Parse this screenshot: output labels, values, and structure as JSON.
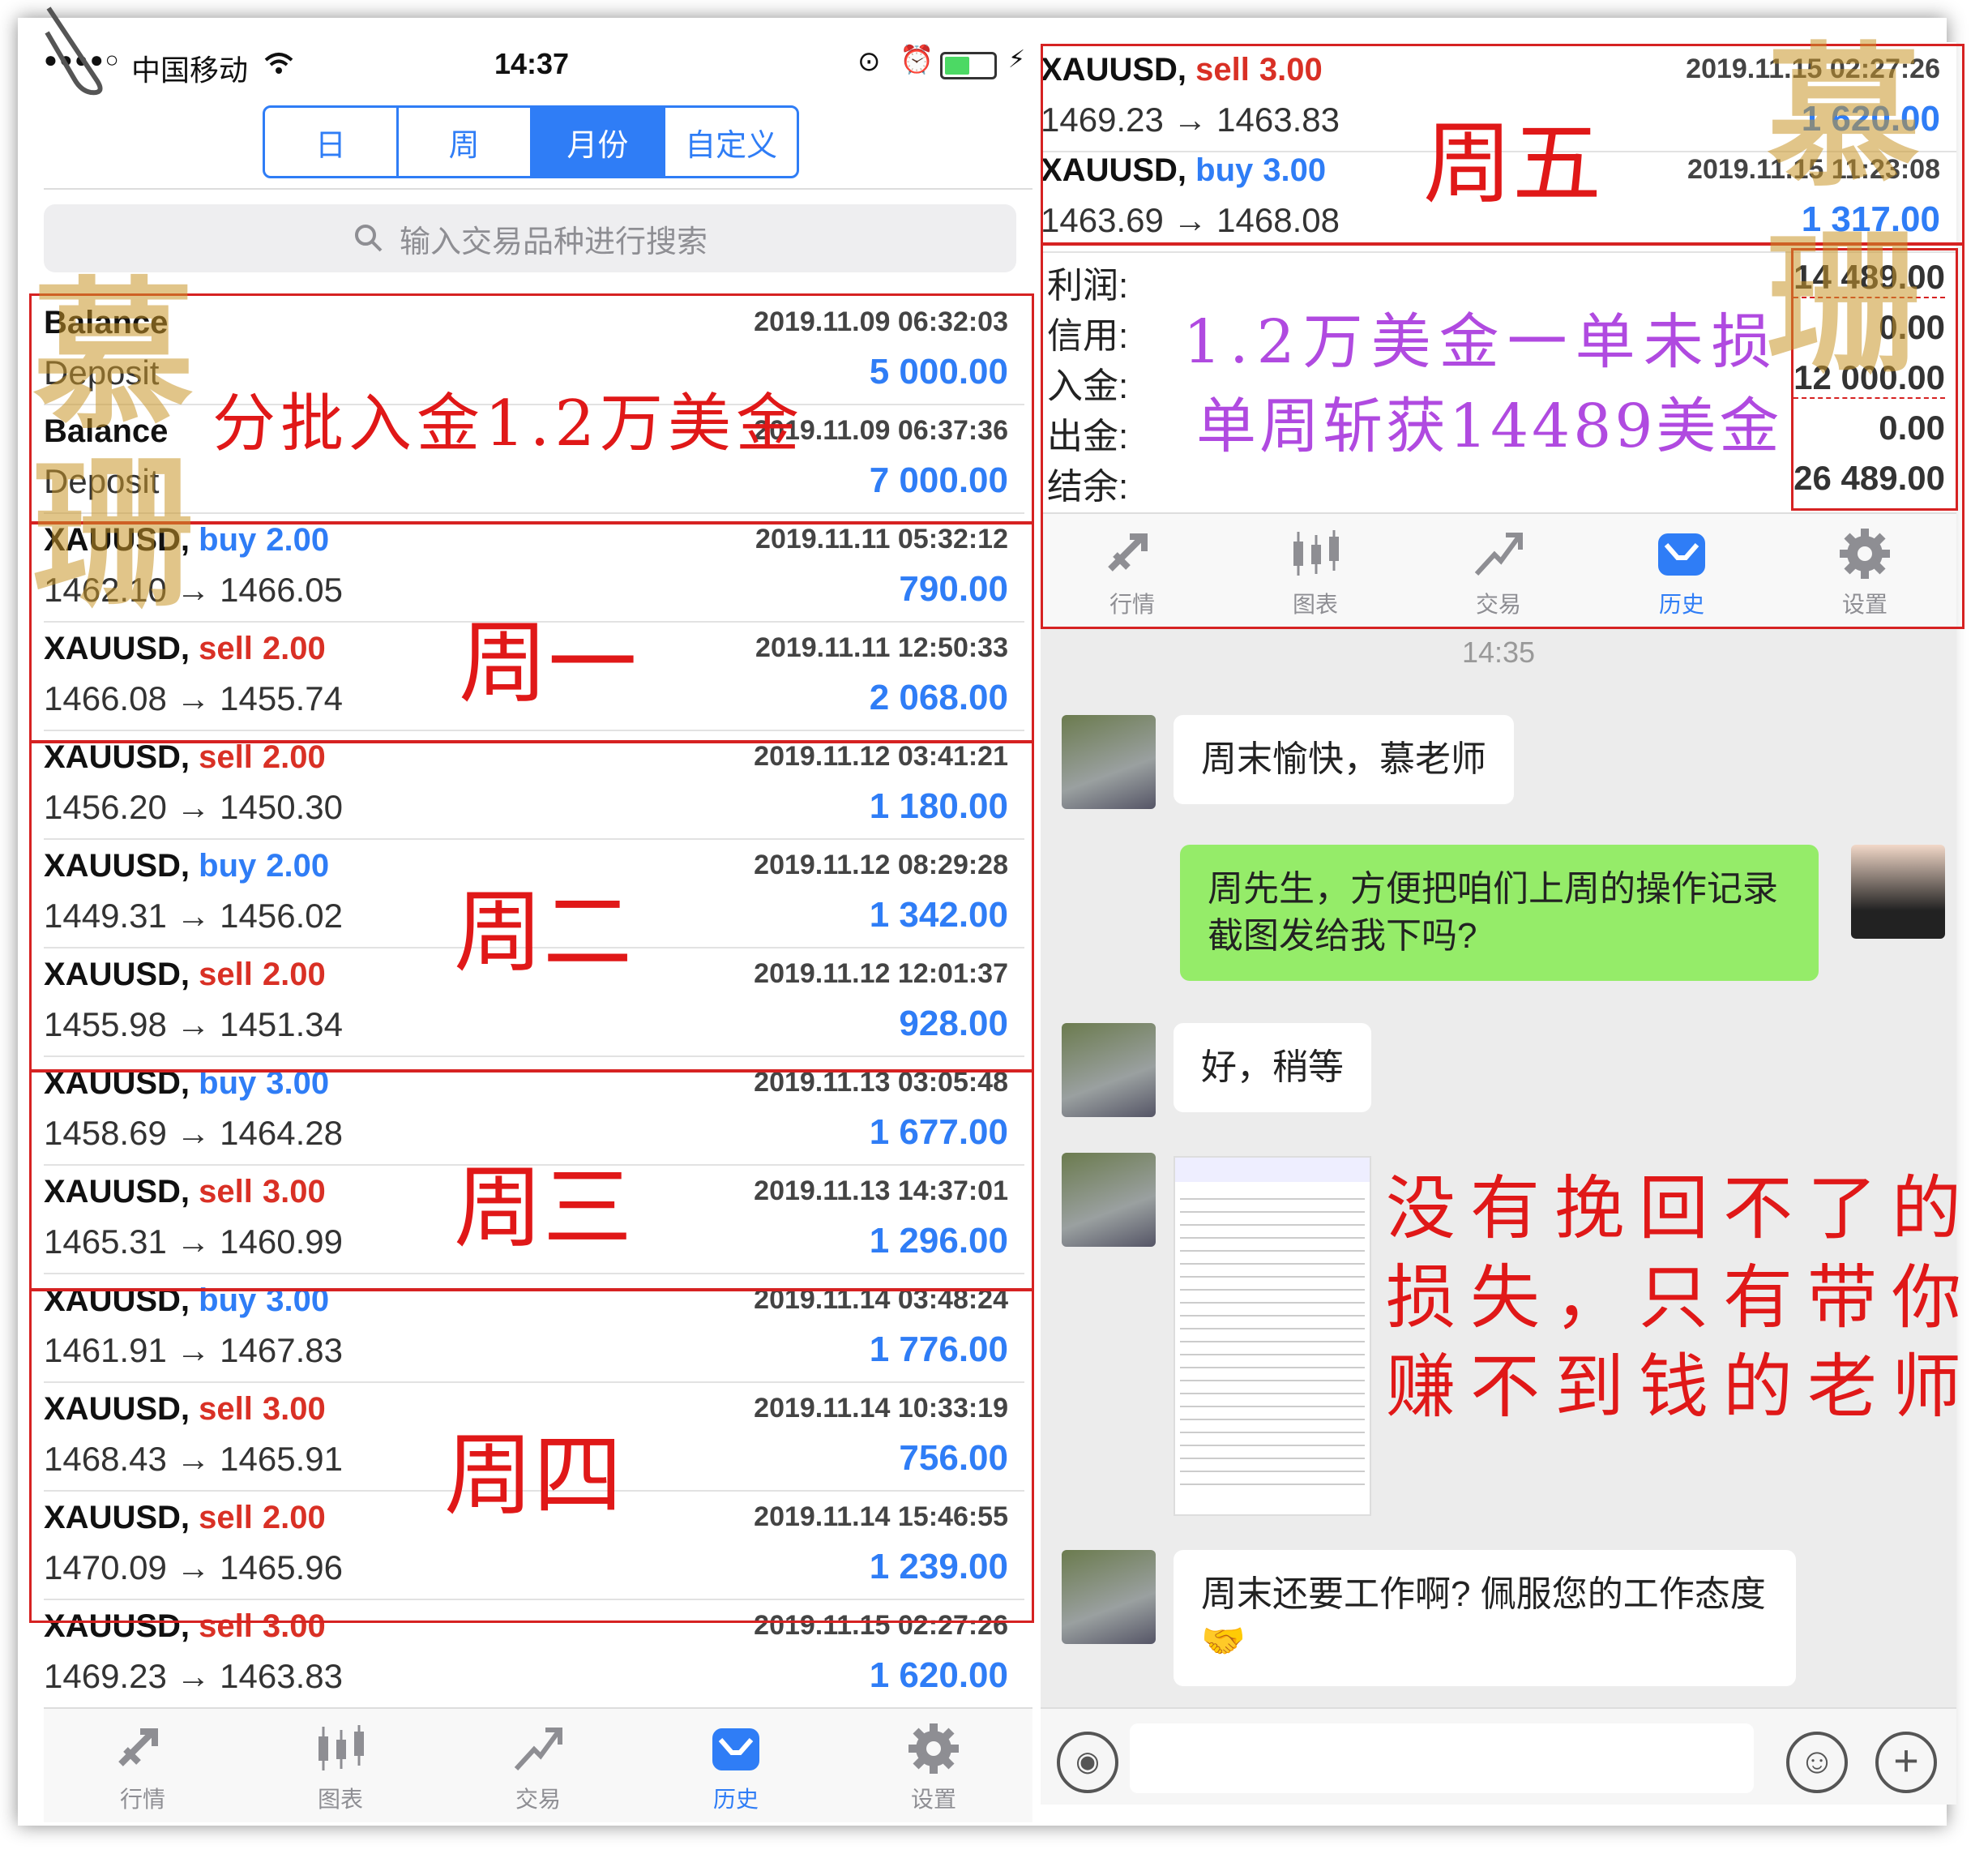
{
  "status_bar": {
    "carrier": "中国移动",
    "time": "14:37"
  },
  "segments": [
    "日",
    "周",
    "月份",
    "自定义"
  ],
  "search_placeholder": "输入交易品种进行搜索",
  "left_rows": [
    {
      "symbol": "Balance",
      "side": "",
      "lot": "",
      "time": "2019.11.09 06:32:03",
      "price": "Deposit",
      "profit": "5 000.00"
    },
    {
      "symbol": "Balance",
      "side": "",
      "lot": "",
      "time": "2019.11.09 06:37:36",
      "price": "Deposit",
      "profit": "7 000.00"
    },
    {
      "symbol": "XAUUSD, ",
      "side": "buy",
      "lot": "2.00",
      "time": "2019.11.11 05:32:12",
      "price": "1462.10 → 1466.05",
      "profit": "790.00"
    },
    {
      "symbol": "XAUUSD, ",
      "side": "sell",
      "lot": "2.00",
      "time": "2019.11.11 12:50:33",
      "price": "1466.08 → 1455.74",
      "profit": "2 068.00"
    },
    {
      "symbol": "XAUUSD, ",
      "side": "sell",
      "lot": "2.00",
      "time": "2019.11.12 03:41:21",
      "price": "1456.20 → 1450.30",
      "profit": "1 180.00"
    },
    {
      "symbol": "XAUUSD, ",
      "side": "buy",
      "lot": "2.00",
      "time": "2019.11.12 08:29:28",
      "price": "1449.31 → 1456.02",
      "profit": "1 342.00"
    },
    {
      "symbol": "XAUUSD, ",
      "side": "sell",
      "lot": "2.00",
      "time": "2019.11.12 12:01:37",
      "price": "1455.98 → 1451.34",
      "profit": "928.00"
    },
    {
      "symbol": "XAUUSD, ",
      "side": "buy",
      "lot": "3.00",
      "time": "2019.11.13 03:05:48",
      "price": "1458.69 → 1464.28",
      "profit": "1 677.00"
    },
    {
      "symbol": "XAUUSD, ",
      "side": "sell",
      "lot": "3.00",
      "time": "2019.11.13 14:37:01",
      "price": "1465.31 → 1460.99",
      "profit": "1 296.00"
    },
    {
      "symbol": "XAUUSD, ",
      "side": "buy",
      "lot": "3.00",
      "time": "2019.11.14 03:48:24",
      "price": "1461.91 → 1467.83",
      "profit": "1 776.00"
    },
    {
      "symbol": "XAUUSD, ",
      "side": "sell",
      "lot": "3.00",
      "time": "2019.11.14 10:33:19",
      "price": "1468.43 → 1465.91",
      "profit": "756.00"
    },
    {
      "symbol": "XAUUSD, ",
      "side": "sell",
      "lot": "2.00",
      "time": "2019.11.14 15:46:55",
      "price": "1470.09 → 1465.96",
      "profit": "1 239.00"
    },
    {
      "symbol": "XAUUSD, ",
      "side": "sell",
      "lot": "3.00",
      "time": "2019.11.15 02:27:26",
      "price": "1469.23 → 1463.83",
      "profit": "1 620.00"
    }
  ],
  "right_rows": [
    {
      "symbol": "XAUUSD, ",
      "side": "sell",
      "lot": "3.00",
      "time": "2019.11.15 02:27:26",
      "price": "1469.23 → 1463.83",
      "profit": "1 620.00"
    },
    {
      "symbol": "XAUUSD, ",
      "side": "buy",
      "lot": "3.00",
      "time": "2019.11.15 11:23:08",
      "price": "1463.69 → 1468.08",
      "profit": "1 317.00"
    }
  ],
  "summary": [
    {
      "label": "利润:",
      "value": "14 489.00"
    },
    {
      "label": "信用:",
      "value": "0.00"
    },
    {
      "label": "入金:",
      "value": "12 000.00"
    },
    {
      "label": "出金:",
      "value": "0.00"
    },
    {
      "label": "结余:",
      "value": "26 489.00"
    }
  ],
  "tabs": [
    "行情",
    "图表",
    "交易",
    "历史",
    "设置"
  ],
  "chat": {
    "time": "14:35",
    "msg1": "周末愉快，慕老师",
    "msg2": "周先生，方便把咱们上周的操作记录截图发给我下吗?",
    "msg3": "好，稍等",
    "msg4": "周末还要工作啊? 佩服您的工作态度🤝"
  },
  "annotations": {
    "deposit": "分批入金1.2万美金",
    "mon": "周一",
    "tue": "周二",
    "wed": "周三",
    "thu": "周四",
    "fri": "周五",
    "summary1": "1.2万美金一单未损",
    "summary2": "单周斩获14489美金",
    "slogan1": "没有挽回不了的",
    "slogan2": "损失，只有带你",
    "slogan3": "赚不到钱的老师"
  },
  "colors": {
    "accent": "#2f7df6",
    "sell": "#d93025",
    "annotation": "#e01818",
    "annotation_purple": "#b04ae0",
    "chat_me": "#95ec69"
  }
}
